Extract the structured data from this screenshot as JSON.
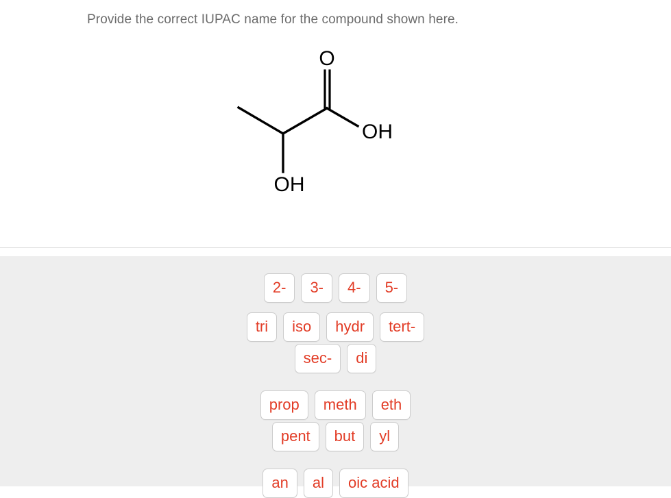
{
  "prompt": {
    "text": "Provide the correct IUPAC name for the compound shown here.",
    "color": "#6b6b6b"
  },
  "molecule": {
    "name": "lactic-acid-skeletal-structure",
    "labels": {
      "carbonyl_oxygen": "O",
      "hydroxyl_acid": "OH",
      "hydroxyl_alpha": "OH"
    },
    "bond_color": "#000000",
    "label_color": "#000000"
  },
  "answer_tray": {
    "background": "#eeeeee",
    "token_color": "#e23c26",
    "token_border": "#cccccc",
    "rows": [
      {
        "tokens": [
          "2-",
          "3-",
          "4-",
          "5-"
        ]
      },
      {
        "tokens": [
          "tri",
          "iso",
          "hydr",
          "tert-"
        ]
      },
      {
        "tokens": [
          "sec-",
          "di"
        ]
      },
      {
        "tokens": [
          "prop",
          "meth",
          "eth"
        ]
      },
      {
        "tokens": [
          "pent",
          "but",
          "yl"
        ]
      },
      {
        "tokens": [
          "an",
          "al",
          "oic acid"
        ]
      }
    ]
  }
}
